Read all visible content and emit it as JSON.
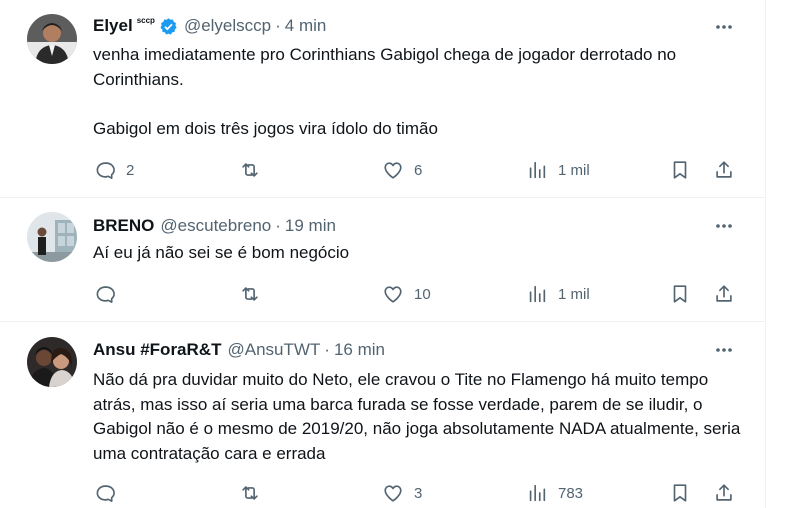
{
  "tweets": [
    {
      "name": "Elyel",
      "name_suffix": "sccp",
      "verified": true,
      "handle": "@elyelsccp",
      "time": "4 min",
      "paragraphs": [
        "venha imediatamente pro Corinthians Gabigol chega de jogador derrotado no Corinthians.",
        "Gabigol em dois três jogos vira ídolo do timão"
      ],
      "replies": "2",
      "retweets": "",
      "likes": "6",
      "views": "1 mil"
    },
    {
      "name": "BRENO",
      "handle": "@escutebreno",
      "time": "19 min",
      "paragraphs": [
        "Aí eu já não sei se é bom negócio"
      ],
      "replies": "",
      "retweets": "",
      "likes": "10",
      "views": "1 mil"
    },
    {
      "name": "Ansu #ForaR&T",
      "handle": "@AnsuTWT",
      "time": "16 min",
      "paragraphs": [
        "Não dá pra duvidar muito do Neto, ele cravou o Tite no Flamengo há muito tempo atrás, mas isso aí seria uma barca furada se fosse verdade, parem de se iludir, o Gabigol não é o mesmo de 2019/20, não joga absolutamente NADA atualmente, seria uma contratação cara e errada"
      ],
      "replies": "",
      "retweets": "",
      "likes": "3",
      "views": "783"
    }
  ],
  "separator": "·",
  "colors": {
    "text": "#0f1419",
    "secondary": "#536471",
    "verified": "#1d9bf0",
    "divider": "#eff3f4"
  },
  "icons": [
    "more-icon",
    "reply-icon",
    "retweet-icon",
    "like-icon",
    "views-icon",
    "bookmark-icon",
    "share-icon",
    "verified-icon"
  ]
}
